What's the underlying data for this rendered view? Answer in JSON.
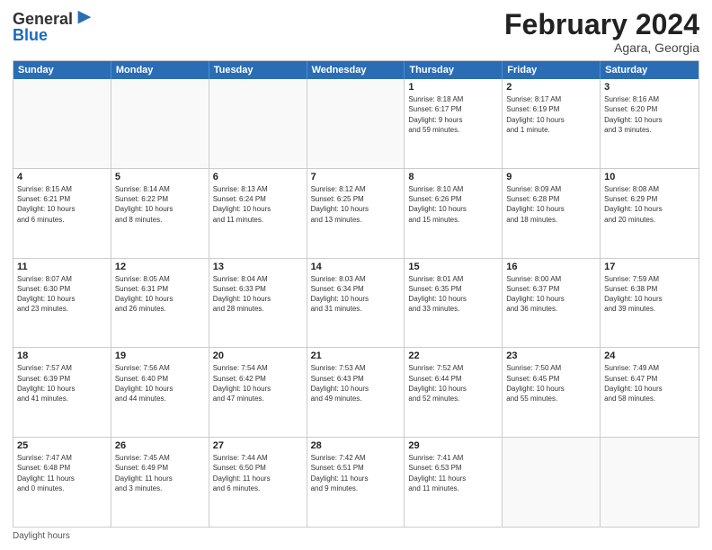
{
  "header": {
    "logo_line1": "General",
    "logo_line2": "Blue",
    "title": "February 2024",
    "subtitle": "Agara, Georgia"
  },
  "weekdays": [
    "Sunday",
    "Monday",
    "Tuesday",
    "Wednesday",
    "Thursday",
    "Friday",
    "Saturday"
  ],
  "footer": "Daylight hours",
  "weeks": [
    [
      {
        "day": "",
        "info": ""
      },
      {
        "day": "",
        "info": ""
      },
      {
        "day": "",
        "info": ""
      },
      {
        "day": "",
        "info": ""
      },
      {
        "day": "1",
        "info": "Sunrise: 8:18 AM\nSunset: 6:17 PM\nDaylight: 9 hours\nand 59 minutes."
      },
      {
        "day": "2",
        "info": "Sunrise: 8:17 AM\nSunset: 6:19 PM\nDaylight: 10 hours\nand 1 minute."
      },
      {
        "day": "3",
        "info": "Sunrise: 8:16 AM\nSunset: 6:20 PM\nDaylight: 10 hours\nand 3 minutes."
      }
    ],
    [
      {
        "day": "4",
        "info": "Sunrise: 8:15 AM\nSunset: 6:21 PM\nDaylight: 10 hours\nand 6 minutes."
      },
      {
        "day": "5",
        "info": "Sunrise: 8:14 AM\nSunset: 6:22 PM\nDaylight: 10 hours\nand 8 minutes."
      },
      {
        "day": "6",
        "info": "Sunrise: 8:13 AM\nSunset: 6:24 PM\nDaylight: 10 hours\nand 11 minutes."
      },
      {
        "day": "7",
        "info": "Sunrise: 8:12 AM\nSunset: 6:25 PM\nDaylight: 10 hours\nand 13 minutes."
      },
      {
        "day": "8",
        "info": "Sunrise: 8:10 AM\nSunset: 6:26 PM\nDaylight: 10 hours\nand 15 minutes."
      },
      {
        "day": "9",
        "info": "Sunrise: 8:09 AM\nSunset: 6:28 PM\nDaylight: 10 hours\nand 18 minutes."
      },
      {
        "day": "10",
        "info": "Sunrise: 8:08 AM\nSunset: 6:29 PM\nDaylight: 10 hours\nand 20 minutes."
      }
    ],
    [
      {
        "day": "11",
        "info": "Sunrise: 8:07 AM\nSunset: 6:30 PM\nDaylight: 10 hours\nand 23 minutes."
      },
      {
        "day": "12",
        "info": "Sunrise: 8:05 AM\nSunset: 6:31 PM\nDaylight: 10 hours\nand 26 minutes."
      },
      {
        "day": "13",
        "info": "Sunrise: 8:04 AM\nSunset: 6:33 PM\nDaylight: 10 hours\nand 28 minutes."
      },
      {
        "day": "14",
        "info": "Sunrise: 8:03 AM\nSunset: 6:34 PM\nDaylight: 10 hours\nand 31 minutes."
      },
      {
        "day": "15",
        "info": "Sunrise: 8:01 AM\nSunset: 6:35 PM\nDaylight: 10 hours\nand 33 minutes."
      },
      {
        "day": "16",
        "info": "Sunrise: 8:00 AM\nSunset: 6:37 PM\nDaylight: 10 hours\nand 36 minutes."
      },
      {
        "day": "17",
        "info": "Sunrise: 7:59 AM\nSunset: 6:38 PM\nDaylight: 10 hours\nand 39 minutes."
      }
    ],
    [
      {
        "day": "18",
        "info": "Sunrise: 7:57 AM\nSunset: 6:39 PM\nDaylight: 10 hours\nand 41 minutes."
      },
      {
        "day": "19",
        "info": "Sunrise: 7:56 AM\nSunset: 6:40 PM\nDaylight: 10 hours\nand 44 minutes."
      },
      {
        "day": "20",
        "info": "Sunrise: 7:54 AM\nSunset: 6:42 PM\nDaylight: 10 hours\nand 47 minutes."
      },
      {
        "day": "21",
        "info": "Sunrise: 7:53 AM\nSunset: 6:43 PM\nDaylight: 10 hours\nand 49 minutes."
      },
      {
        "day": "22",
        "info": "Sunrise: 7:52 AM\nSunset: 6:44 PM\nDaylight: 10 hours\nand 52 minutes."
      },
      {
        "day": "23",
        "info": "Sunrise: 7:50 AM\nSunset: 6:45 PM\nDaylight: 10 hours\nand 55 minutes."
      },
      {
        "day": "24",
        "info": "Sunrise: 7:49 AM\nSunset: 6:47 PM\nDaylight: 10 hours\nand 58 minutes."
      }
    ],
    [
      {
        "day": "25",
        "info": "Sunrise: 7:47 AM\nSunset: 6:48 PM\nDaylight: 11 hours\nand 0 minutes."
      },
      {
        "day": "26",
        "info": "Sunrise: 7:45 AM\nSunset: 6:49 PM\nDaylight: 11 hours\nand 3 minutes."
      },
      {
        "day": "27",
        "info": "Sunrise: 7:44 AM\nSunset: 6:50 PM\nDaylight: 11 hours\nand 6 minutes."
      },
      {
        "day": "28",
        "info": "Sunrise: 7:42 AM\nSunset: 6:51 PM\nDaylight: 11 hours\nand 9 minutes."
      },
      {
        "day": "29",
        "info": "Sunrise: 7:41 AM\nSunset: 6:53 PM\nDaylight: 11 hours\nand 11 minutes."
      },
      {
        "day": "",
        "info": ""
      },
      {
        "day": "",
        "info": ""
      }
    ]
  ]
}
